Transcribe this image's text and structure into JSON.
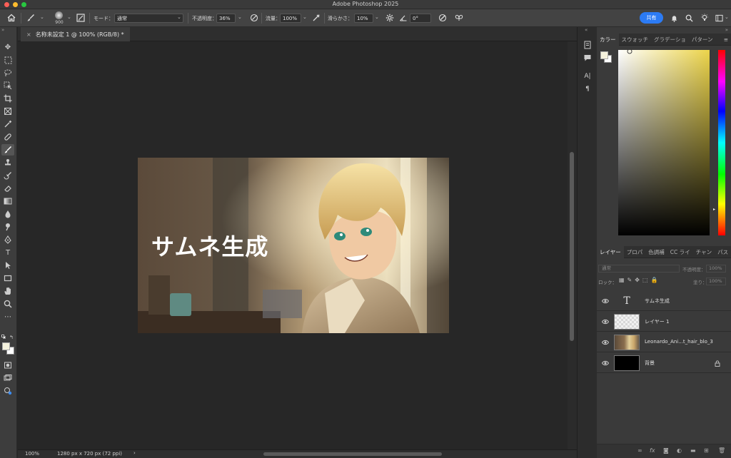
{
  "window": {
    "title": "Adobe Photoshop 2025"
  },
  "options_bar": {
    "brush_size": "900",
    "mode_label": "モード：",
    "mode_value": "通常",
    "opacity_label": "不透明度：",
    "opacity_value": "36%",
    "flow_label": "流量：",
    "flow_value": "100%",
    "smoothing_label": "滑らかさ：",
    "smoothing_value": "10%",
    "angle_value": "0°",
    "share_label": "共有"
  },
  "document": {
    "tab_title": "名称未設定 1 @ 100% (RGB/8) *",
    "close_glyph": "×",
    "canvas_text": "サムネ生成"
  },
  "status_bar": {
    "zoom": "100%",
    "doc_info": "1280 px x 720 px (72 ppi)",
    "arrow": "›"
  },
  "color_panel": {
    "tabs": [
      "カラー",
      "スウォッチ",
      "グラデーショ",
      "パターン"
    ]
  },
  "layers_panel": {
    "tabs": [
      "レイヤー",
      "プロパ",
      "色調補",
      "CC ライ",
      "チャン",
      "パス"
    ],
    "blend_mode": "通常",
    "opacity_label": "不透明度：",
    "opacity_value": "100%",
    "lock_label": "ロック：",
    "fill_label": "塗り：",
    "fill_value": "100%",
    "layers": [
      {
        "name": "サムネ生成",
        "type": "text"
      },
      {
        "name": "レイヤー 1",
        "type": "transparent"
      },
      {
        "name": "Leonardo_Ani...t_hair_blo_3",
        "type": "image"
      },
      {
        "name": "背景",
        "type": "background"
      }
    ]
  },
  "colors": {
    "foreground": "#f4f1dc",
    "background": "#ffffff",
    "accent": "#2c7bf4",
    "canvas_bg": "#272727"
  }
}
